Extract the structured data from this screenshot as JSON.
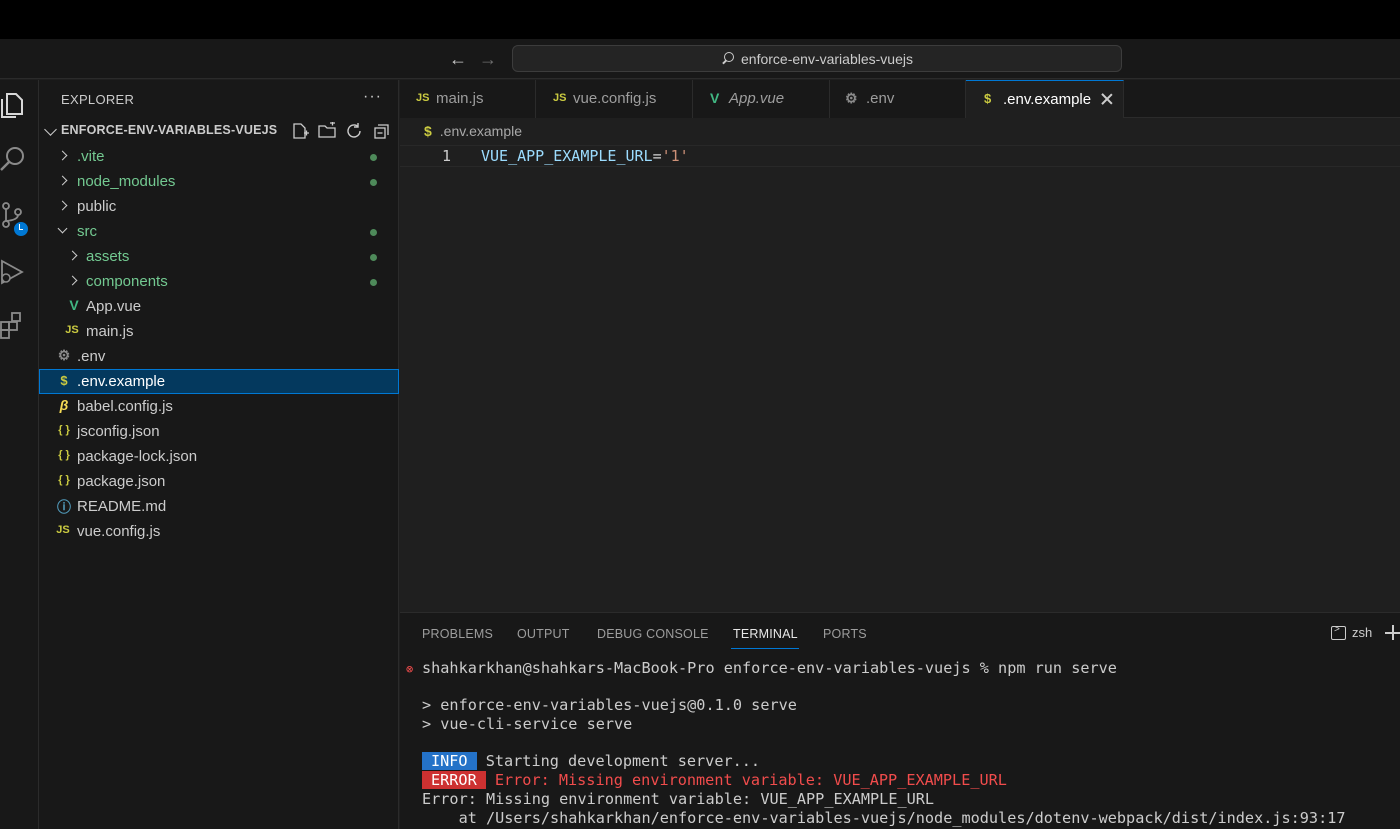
{
  "titlebar": {
    "search_text": "enforce-env-variables-vuejs",
    "back_icon": "arrow-left-icon",
    "forward_icon": "arrow-right-icon"
  },
  "activity_bar": {
    "items": [
      "explorer-icon",
      "search-icon",
      "source-control-icon",
      "run-debug-icon",
      "extensions-icon"
    ]
  },
  "sidebar": {
    "title": "EXPLORER",
    "more": "···",
    "folder": "ENFORCE-ENV-VARIABLES-VUEJS",
    "actions": [
      "new-file-icon",
      "new-folder-icon",
      "refresh-icon",
      "collapse-all-icon"
    ],
    "tree": [
      {
        "label": ".vite"
      },
      {
        "label": "node_modules"
      },
      {
        "label": "public"
      },
      {
        "label": "src"
      },
      {
        "label": "assets"
      },
      {
        "label": "components"
      },
      {
        "label": "App.vue",
        "icon_text": "V"
      },
      {
        "label": "main.js",
        "icon_text": "JS"
      },
      {
        "label": ".env",
        "icon_text": "⚙"
      },
      {
        "label": ".env.example",
        "icon_text": "$"
      },
      {
        "label": "babel.config.js",
        "icon_text": "β"
      },
      {
        "label": "jsconfig.json",
        "icon_text": "{ }"
      },
      {
        "label": "package-lock.json",
        "icon_text": "{ }"
      },
      {
        "label": "package.json",
        "icon_text": "{ }"
      },
      {
        "label": "README.md",
        "icon_text": "ⓘ"
      },
      {
        "label": "vue.config.js",
        "icon_text": "JS"
      }
    ]
  },
  "editor": {
    "tabs": [
      {
        "label": "main.js",
        "icon_text": "JS"
      },
      {
        "label": "vue.config.js",
        "icon_text": "JS"
      },
      {
        "label": "App.vue",
        "icon_text": "V"
      },
      {
        "label": ".env",
        "icon_text": "⚙"
      },
      {
        "label": ".env.example",
        "icon_text": "$"
      }
    ],
    "breadcrumb": ".env.example",
    "breadcrumb_icon": "$",
    "lines": [
      {
        "number": "1",
        "key": "VUE_APP_EXAMPLE_URL",
        "op": "=",
        "value": "'1'"
      }
    ]
  },
  "panel": {
    "tabs": [
      "PROBLEMS",
      "OUTPUT",
      "DEBUG CONSOLE",
      "TERMINAL",
      "PORTS"
    ],
    "active_tab": "TERMINAL",
    "shell": "zsh",
    "terminal": {
      "prompt": "shahkarkhan@shahkars-MacBook-Pro enforce-env-variables-vuejs % npm run serve",
      "line1": "> enforce-env-variables-vuejs@0.1.0 serve",
      "line2": "> vue-cli-service serve",
      "info_badge": "INFO",
      "info_text": "Starting development server...",
      "error_badge": "ERROR",
      "error_text": "Error: Missing environment variable: VUE_APP_EXAMPLE_URL",
      "error_line": "Error: Missing environment variable: VUE_APP_EXAMPLE_URL",
      "stack_line": "    at /Users/shahkarkhan/enforce-env-variables-vuejs/node_modules/dotenv-webpack/dist/index.js:93:17"
    }
  },
  "colors": {
    "accent": "#0078d4",
    "git_untracked": "#73c991",
    "error": "#f14c4c"
  }
}
